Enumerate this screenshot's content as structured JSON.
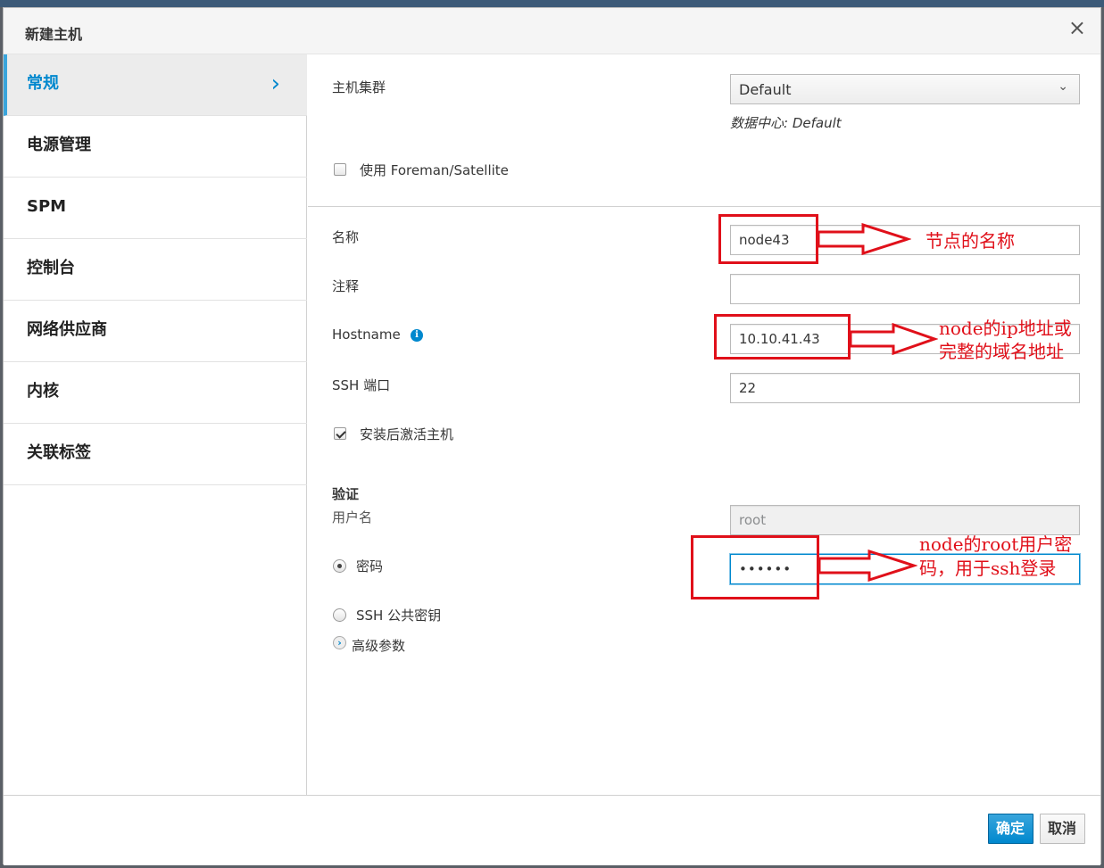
{
  "dialog": {
    "title": "新建主机",
    "close_icon": "×"
  },
  "sidebar": {
    "items": [
      {
        "label": "常规",
        "active": true
      },
      {
        "label": "电源管理"
      },
      {
        "label": "SPM"
      },
      {
        "label": "控制台"
      },
      {
        "label": "网络供应商"
      },
      {
        "label": "内核"
      },
      {
        "label": "关联标签"
      }
    ],
    "chevron": "›"
  },
  "form": {
    "cluster_label": "主机集群",
    "cluster_value": "Default",
    "cluster_caret": "⌄",
    "datacenter_text": "数据中心: Default",
    "foreman_label": "使用 Foreman/Satellite",
    "foreman_checked": false,
    "name_label": "名称",
    "name_value": "node43",
    "comment_label": "注释",
    "comment_value": "",
    "hostname_label": "Hostname",
    "hostname_value": "10.10.41.43",
    "ssh_port_label": "SSH 端口",
    "ssh_port_value": "22",
    "activate_label": "安装后激活主机",
    "activate_checked": true,
    "auth_heading": "验证",
    "username_label": "用户名",
    "username_value": "root",
    "password_label": "密码",
    "password_value": "••••••",
    "password_selected": true,
    "sshkey_label": "SSH 公共密钥",
    "advanced_label": "高级参数"
  },
  "footer": {
    "ok_label": "确定",
    "cancel_label": "取消"
  },
  "annotations": {
    "name_note": "节点的名称",
    "hostname_note_line1": "node的ip地址或",
    "hostname_note_line2": "完整的域名地址",
    "password_note_line1": "node的root用户密",
    "password_note_line2": "码，用于ssh登录"
  },
  "colors": {
    "accent": "#0088ce",
    "annotation_red": "#e0101a"
  }
}
